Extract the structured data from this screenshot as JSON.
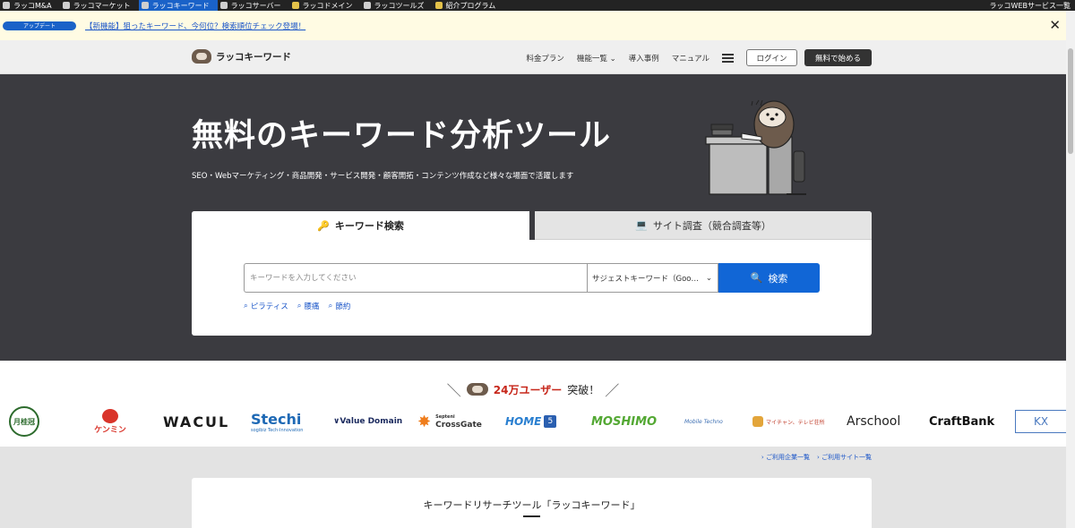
{
  "service_bar": {
    "items": [
      {
        "label": "ラッコM&A",
        "active": false
      },
      {
        "label": "ラッコマーケット",
        "active": false
      },
      {
        "label": "ラッコキーワード",
        "active": true
      },
      {
        "label": "ラッコサーバー",
        "active": false
      },
      {
        "label": "ラッコドメイン",
        "active": false
      },
      {
        "label": "ラッコツールズ",
        "active": false
      },
      {
        "label": "紹介プログラム",
        "active": false
      }
    ],
    "right_label": "ラッコWEBサービス一覧"
  },
  "banner": {
    "badge": "アップデート",
    "link_text": "【新機能】狙ったキーワード、今何位？検索順位チェック登場！",
    "close": "✕"
  },
  "header": {
    "logo_text": "ラッコキーワード",
    "nav": [
      "料金プラン",
      "機能一覧",
      "導入事例",
      "マニュアル"
    ],
    "login_label": "ログイン",
    "free_start_label": "無料で始める"
  },
  "hero": {
    "title": "無料のキーワード分析ツール",
    "subtitle": "SEO・Webマーケティング・商品開発・サービス開発・顧客開拓・コンテンツ作成など様々な場面で活躍します"
  },
  "search": {
    "tab_keyword": "キーワード検索",
    "tab_site": "サイト調査（競合調査等）",
    "placeholder": "キーワードを入力してください",
    "suggest_value": "サジェストキーワード（Google）",
    "button_label": "検索",
    "examples": [
      "ピラティス",
      "腰痛",
      "節約"
    ]
  },
  "users": {
    "count": "24万ユーザー",
    "suffix": "突破！",
    "logos": [
      {
        "name": "月桂冠",
        "text": "月桂冠"
      },
      {
        "name": "ケンミン",
        "text": "ケンミン"
      },
      {
        "name": "wacul",
        "text": "WACUL"
      },
      {
        "name": "stechi",
        "text": "Stechi"
      },
      {
        "name": "stechi-tag",
        "text": "sogibiz Tech-Innovation"
      },
      {
        "name": "value-domain",
        "text": "Value Domain"
      },
      {
        "name": "crossgate-top",
        "text": "Septeni"
      },
      {
        "name": "crossgate",
        "text": "CrossGate"
      },
      {
        "name": "home5",
        "text": "HOME"
      },
      {
        "name": "home5-num",
        "text": "5"
      },
      {
        "name": "moshimo",
        "text": "MOSHIMO"
      },
      {
        "name": "mobile-techno",
        "text": "Mobile Techno"
      },
      {
        "name": "maichan",
        "text": "マイチャン、テレビ荘所"
      },
      {
        "name": "arschool",
        "text": "Arschool"
      },
      {
        "name": "craftbank",
        "text": "CraftBank"
      },
      {
        "name": "kobayashi",
        "text": "KX"
      }
    ]
  },
  "links": {
    "companies": "ご利用企業一覧",
    "sites": "ご利用サイト一覧"
  },
  "intro": {
    "title": "キーワードリサーチツール「ラッコキーワード」"
  }
}
